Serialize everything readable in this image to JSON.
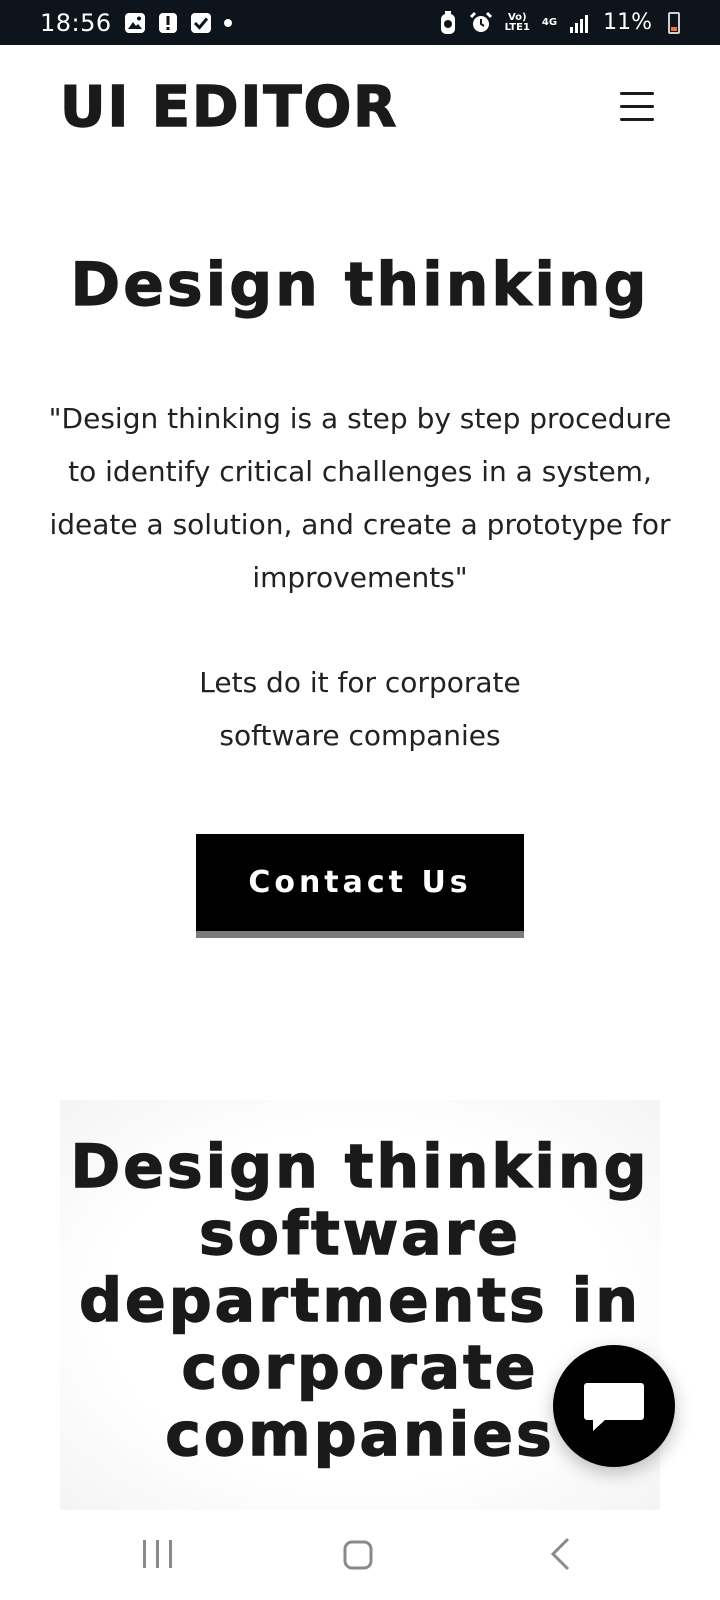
{
  "status_bar": {
    "time": "18:56",
    "left_icons": [
      "gallery-icon",
      "alert-icon",
      "check-icon",
      "dot-icon"
    ],
    "right_icons": [
      "battery-saver-icon",
      "alarm-icon",
      "volte-icon",
      "4g-icon",
      "signal-icon"
    ],
    "volte_text": "Vo)\nLTE1",
    "network_text": "4G",
    "battery_percent": "11%"
  },
  "header": {
    "logo": "UI EDITOR",
    "menu_icon": "hamburger-icon"
  },
  "hero": {
    "title": "Design thinking",
    "quote": "\"Design thinking is a step by step procedure to identify critical challenges in a system, ideate a solution, and create a prototype for improvements\"",
    "subtitle": "Lets do it for corporate software companies",
    "cta_label": "Contact Us"
  },
  "section_two": {
    "title": "Design thinking software departments in corporate companies"
  },
  "chat": {
    "icon": "chat-bubble-icon"
  },
  "nav_bar": {
    "icons": [
      "recents-icon",
      "home-icon",
      "back-icon"
    ]
  },
  "colors": {
    "status_bar_bg": "#0e141b",
    "text": "#1a1a1a",
    "button_bg": "#000000",
    "button_border": "#7b7b7b",
    "battery_low": "#ff6a3d"
  }
}
